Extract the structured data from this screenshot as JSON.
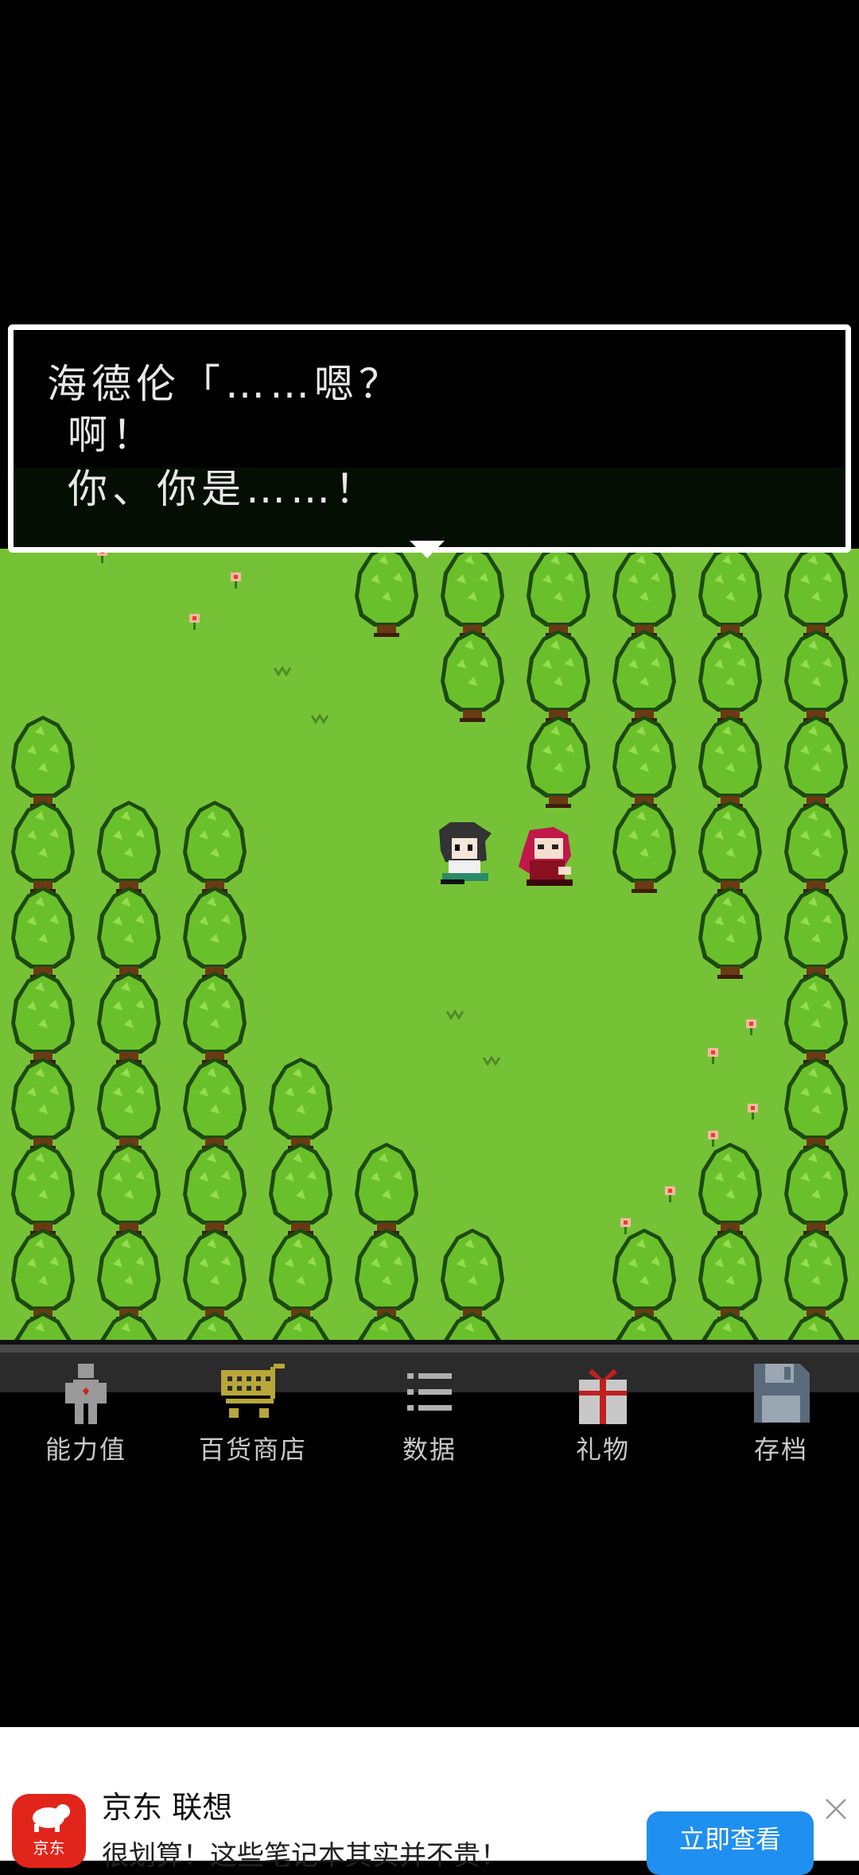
{
  "dialog": {
    "line1": "海德伦「……嗯？",
    "line2": "啊！",
    "line3": "你、你是……！"
  },
  "scene": {
    "grass_color": "#76c236",
    "tree_color": "#6ac02a",
    "characters": [
      "black-haired-hero",
      "red-haired-heroine"
    ]
  },
  "menu": {
    "items": [
      {
        "label": "能力值",
        "icon": "figure-icon"
      },
      {
        "label": "百货商店",
        "icon": "shopping-cart-icon"
      },
      {
        "label": "数据",
        "icon": "list-icon"
      },
      {
        "label": "礼物",
        "icon": "gift-icon"
      },
      {
        "label": "存档",
        "icon": "floppy-disk-icon"
      }
    ]
  },
  "ad": {
    "logo_text": "京东",
    "title": "京东 联想",
    "description": "很划算！这些笔记本其实并不贵！",
    "cta": "立即查看",
    "accent": "#1f8ff0",
    "logo_color": "#e1251b"
  }
}
